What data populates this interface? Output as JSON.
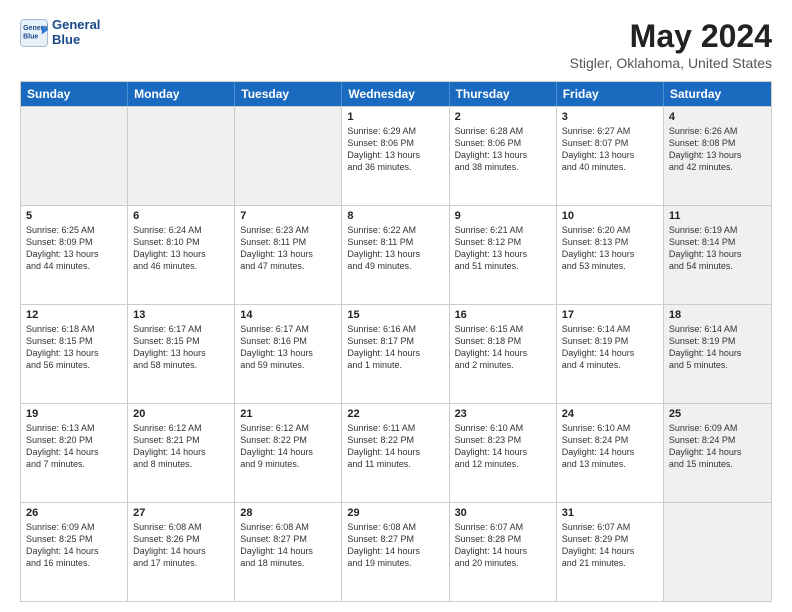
{
  "logo": {
    "line1": "General",
    "line2": "Blue"
  },
  "title": "May 2024",
  "location": "Stigler, Oklahoma, United States",
  "header_days": [
    "Sunday",
    "Monday",
    "Tuesday",
    "Wednesday",
    "Thursday",
    "Friday",
    "Saturday"
  ],
  "weeks": [
    [
      {
        "day": "",
        "info": "",
        "shaded": true
      },
      {
        "day": "",
        "info": "",
        "shaded": true
      },
      {
        "day": "",
        "info": "",
        "shaded": true
      },
      {
        "day": "1",
        "info": "Sunrise: 6:29 AM\nSunset: 8:06 PM\nDaylight: 13 hours\nand 36 minutes.",
        "shaded": false
      },
      {
        "day": "2",
        "info": "Sunrise: 6:28 AM\nSunset: 8:06 PM\nDaylight: 13 hours\nand 38 minutes.",
        "shaded": false
      },
      {
        "day": "3",
        "info": "Sunrise: 6:27 AM\nSunset: 8:07 PM\nDaylight: 13 hours\nand 40 minutes.",
        "shaded": false
      },
      {
        "day": "4",
        "info": "Sunrise: 6:26 AM\nSunset: 8:08 PM\nDaylight: 13 hours\nand 42 minutes.",
        "shaded": true
      }
    ],
    [
      {
        "day": "5",
        "info": "Sunrise: 6:25 AM\nSunset: 8:09 PM\nDaylight: 13 hours\nand 44 minutes.",
        "shaded": false
      },
      {
        "day": "6",
        "info": "Sunrise: 6:24 AM\nSunset: 8:10 PM\nDaylight: 13 hours\nand 46 minutes.",
        "shaded": false
      },
      {
        "day": "7",
        "info": "Sunrise: 6:23 AM\nSunset: 8:11 PM\nDaylight: 13 hours\nand 47 minutes.",
        "shaded": false
      },
      {
        "day": "8",
        "info": "Sunrise: 6:22 AM\nSunset: 8:11 PM\nDaylight: 13 hours\nand 49 minutes.",
        "shaded": false
      },
      {
        "day": "9",
        "info": "Sunrise: 6:21 AM\nSunset: 8:12 PM\nDaylight: 13 hours\nand 51 minutes.",
        "shaded": false
      },
      {
        "day": "10",
        "info": "Sunrise: 6:20 AM\nSunset: 8:13 PM\nDaylight: 13 hours\nand 53 minutes.",
        "shaded": false
      },
      {
        "day": "11",
        "info": "Sunrise: 6:19 AM\nSunset: 8:14 PM\nDaylight: 13 hours\nand 54 minutes.",
        "shaded": true
      }
    ],
    [
      {
        "day": "12",
        "info": "Sunrise: 6:18 AM\nSunset: 8:15 PM\nDaylight: 13 hours\nand 56 minutes.",
        "shaded": false
      },
      {
        "day": "13",
        "info": "Sunrise: 6:17 AM\nSunset: 8:15 PM\nDaylight: 13 hours\nand 58 minutes.",
        "shaded": false
      },
      {
        "day": "14",
        "info": "Sunrise: 6:17 AM\nSunset: 8:16 PM\nDaylight: 13 hours\nand 59 minutes.",
        "shaded": false
      },
      {
        "day": "15",
        "info": "Sunrise: 6:16 AM\nSunset: 8:17 PM\nDaylight: 14 hours\nand 1 minute.",
        "shaded": false
      },
      {
        "day": "16",
        "info": "Sunrise: 6:15 AM\nSunset: 8:18 PM\nDaylight: 14 hours\nand 2 minutes.",
        "shaded": false
      },
      {
        "day": "17",
        "info": "Sunrise: 6:14 AM\nSunset: 8:19 PM\nDaylight: 14 hours\nand 4 minutes.",
        "shaded": false
      },
      {
        "day": "18",
        "info": "Sunrise: 6:14 AM\nSunset: 8:19 PM\nDaylight: 14 hours\nand 5 minutes.",
        "shaded": true
      }
    ],
    [
      {
        "day": "19",
        "info": "Sunrise: 6:13 AM\nSunset: 8:20 PM\nDaylight: 14 hours\nand 7 minutes.",
        "shaded": false
      },
      {
        "day": "20",
        "info": "Sunrise: 6:12 AM\nSunset: 8:21 PM\nDaylight: 14 hours\nand 8 minutes.",
        "shaded": false
      },
      {
        "day": "21",
        "info": "Sunrise: 6:12 AM\nSunset: 8:22 PM\nDaylight: 14 hours\nand 9 minutes.",
        "shaded": false
      },
      {
        "day": "22",
        "info": "Sunrise: 6:11 AM\nSunset: 8:22 PM\nDaylight: 14 hours\nand 11 minutes.",
        "shaded": false
      },
      {
        "day": "23",
        "info": "Sunrise: 6:10 AM\nSunset: 8:23 PM\nDaylight: 14 hours\nand 12 minutes.",
        "shaded": false
      },
      {
        "day": "24",
        "info": "Sunrise: 6:10 AM\nSunset: 8:24 PM\nDaylight: 14 hours\nand 13 minutes.",
        "shaded": false
      },
      {
        "day": "25",
        "info": "Sunrise: 6:09 AM\nSunset: 8:24 PM\nDaylight: 14 hours\nand 15 minutes.",
        "shaded": true
      }
    ],
    [
      {
        "day": "26",
        "info": "Sunrise: 6:09 AM\nSunset: 8:25 PM\nDaylight: 14 hours\nand 16 minutes.",
        "shaded": false
      },
      {
        "day": "27",
        "info": "Sunrise: 6:08 AM\nSunset: 8:26 PM\nDaylight: 14 hours\nand 17 minutes.",
        "shaded": false
      },
      {
        "day": "28",
        "info": "Sunrise: 6:08 AM\nSunset: 8:27 PM\nDaylight: 14 hours\nand 18 minutes.",
        "shaded": false
      },
      {
        "day": "29",
        "info": "Sunrise: 6:08 AM\nSunset: 8:27 PM\nDaylight: 14 hours\nand 19 minutes.",
        "shaded": false
      },
      {
        "day": "30",
        "info": "Sunrise: 6:07 AM\nSunset: 8:28 PM\nDaylight: 14 hours\nand 20 minutes.",
        "shaded": false
      },
      {
        "day": "31",
        "info": "Sunrise: 6:07 AM\nSunset: 8:29 PM\nDaylight: 14 hours\nand 21 minutes.",
        "shaded": false
      },
      {
        "day": "",
        "info": "",
        "shaded": true
      }
    ]
  ]
}
